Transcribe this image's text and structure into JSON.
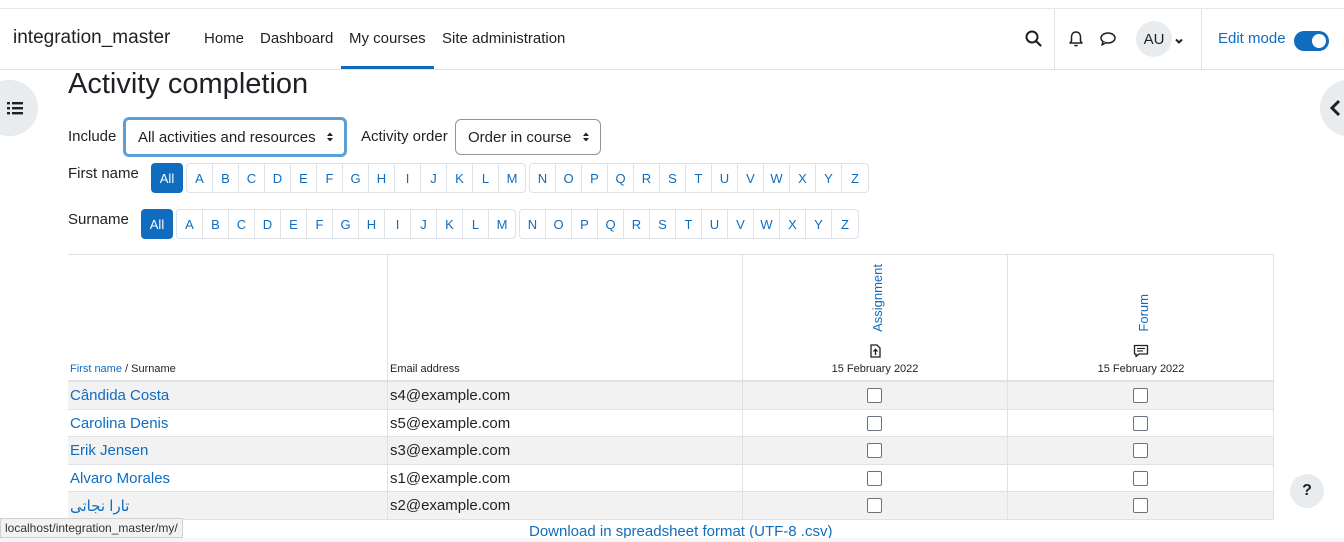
{
  "navbar": {
    "brand": "integration_master",
    "links": [
      "Home",
      "Dashboard",
      "My courses",
      "Site administration"
    ],
    "active_link": "My courses",
    "avatar_initials": "AU",
    "edit_mode_label": "Edit mode",
    "edit_mode_on": true
  },
  "page": {
    "title": "Activity completion"
  },
  "filters": {
    "include_label": "Include",
    "include_value": "All activities and resources",
    "order_label": "Activity order",
    "order_value": "Order in course"
  },
  "initials": {
    "firstname_label": "First name",
    "surname_label": "Surname",
    "all_label": "All",
    "group1": [
      "A",
      "B",
      "C",
      "D",
      "E",
      "F",
      "G",
      "H",
      "I",
      "J",
      "K",
      "L",
      "M"
    ],
    "group2": [
      "N",
      "O",
      "P",
      "Q",
      "R",
      "S",
      "T",
      "U",
      "V",
      "W",
      "X",
      "Y",
      "Z"
    ]
  },
  "table": {
    "col_firstname": "First name",
    "col_surname_sep": " / Surname",
    "col_email": "Email address",
    "activities": [
      {
        "name": "Assignment",
        "icon": "assignment-icon",
        "date": "15 February 2022"
      },
      {
        "name": "Forum",
        "icon": "forum-icon",
        "date": "15 February 2022"
      }
    ],
    "rows": [
      {
        "name": "Cândida Costa",
        "email": "s4@example.com"
      },
      {
        "name": "Carolina Denis",
        "email": "s5@example.com"
      },
      {
        "name": "Erik Jensen",
        "email": "s3@example.com"
      },
      {
        "name": "Alvaro Morales",
        "email": "s1@example.com"
      },
      {
        "name": "تارا نجاتی",
        "email": "s2@example.com"
      }
    ]
  },
  "download_label": "Download in spreadsheet format (UTF-8 .csv)",
  "status_url": "localhost/integration_master/my/",
  "help_label": "?",
  "colors": {
    "accent": "#0f6cbf"
  }
}
